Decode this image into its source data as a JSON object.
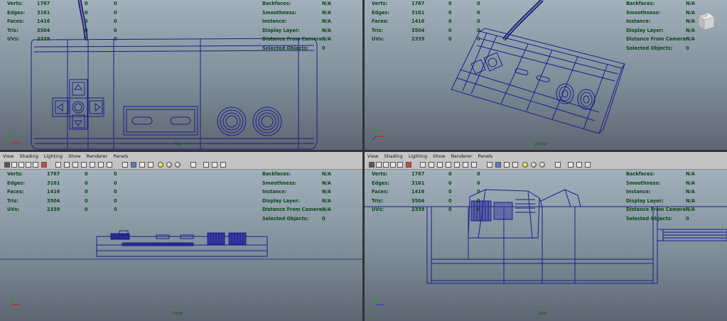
{
  "menu": [
    "View",
    "Shading",
    "Lighting",
    "Show",
    "Renderer",
    "Panels"
  ],
  "stats": [
    {
      "label": "Verts:",
      "v1": "1767",
      "v2": "0",
      "v3": "0"
    },
    {
      "label": "Edges:",
      "v1": "3161",
      "v2": "0",
      "v3": "0"
    },
    {
      "label": "Faces:",
      "v1": "1416",
      "v2": "0",
      "v3": "0"
    },
    {
      "label": "Tris:",
      "v1": "3504",
      "v2": "0",
      "v3": "0"
    },
    {
      "label": "UVs:",
      "v1": "2339",
      "v2": "0",
      "v3": "0"
    }
  ],
  "info": [
    {
      "label": "Backfaces:",
      "value": "N/A"
    },
    {
      "label": "Smoothness:",
      "value": "N/A"
    },
    {
      "label": "Instance:",
      "value": "N/A"
    },
    {
      "label": "Display Layer:",
      "value": "N/A"
    },
    {
      "label": "Distance From Camera:",
      "value": "N/A"
    },
    {
      "label": "Selected Objects:",
      "value": "0"
    }
  ],
  "views": {
    "top_left": {
      "camera": "top"
    },
    "top_right": {
      "camera": "persp",
      "viewcube": "TOP"
    },
    "bottom_left": {
      "camera": "front"
    },
    "bottom_right": {
      "camera": "side"
    }
  },
  "colors": {
    "wire": "#1c1c8c",
    "hud": "#0a4a14",
    "viewport_top": "#a2b0bc",
    "viewport_bottom": "#5d6670"
  }
}
